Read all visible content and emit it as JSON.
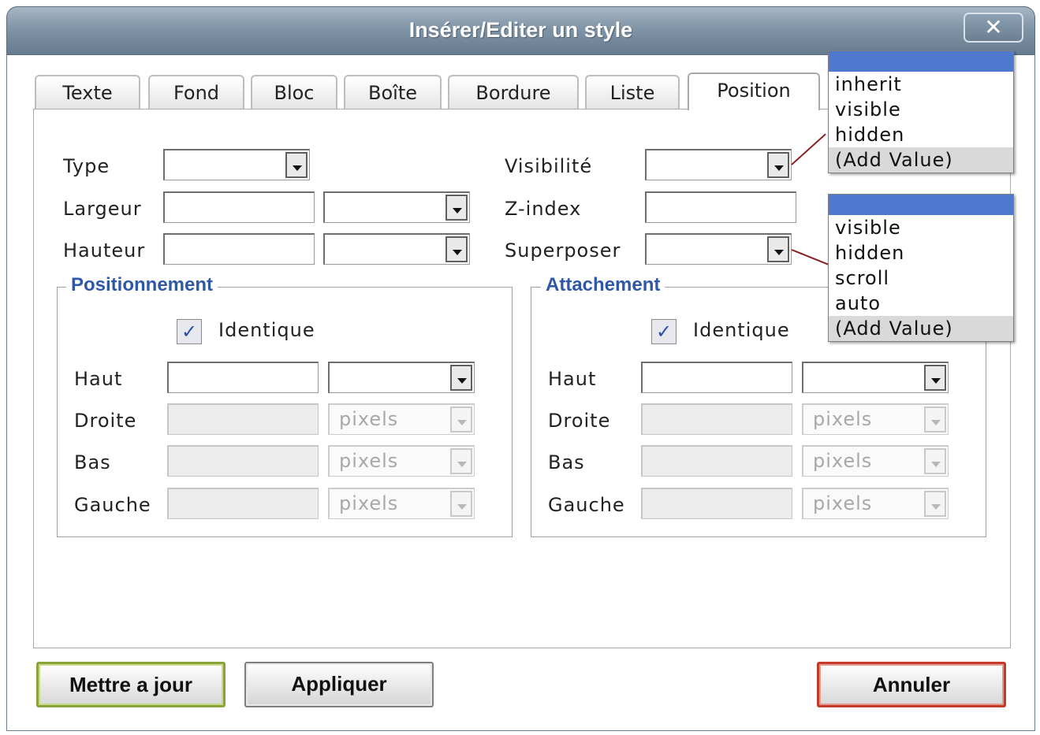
{
  "dialog": {
    "title": "Insérer/Editer un style",
    "close_label": "✕"
  },
  "tabs": [
    {
      "label": "Texte",
      "active": false
    },
    {
      "label": "Fond",
      "active": false
    },
    {
      "label": "Bloc",
      "active": false
    },
    {
      "label": "Boîte",
      "active": false
    },
    {
      "label": "Bordure",
      "active": false
    },
    {
      "label": "Liste",
      "active": false
    },
    {
      "label": "Position",
      "active": true
    }
  ],
  "fields": {
    "type_label": "Type",
    "largeur_label": "Largeur",
    "hauteur_label": "Hauteur",
    "visibilite_label": "Visibilité",
    "zindex_label": "Z-index",
    "superposer_label": "Superposer"
  },
  "positionnement": {
    "legend": "Positionnement",
    "identique_label": "Identique",
    "identique_checked": true,
    "haut_label": "Haut",
    "droite_label": "Droite",
    "bas_label": "Bas",
    "gauche_label": "Gauche",
    "unit_value": "pixels"
  },
  "attachement": {
    "legend": "Attachement",
    "identique_label": "Identique",
    "identique_checked": true,
    "haut_label": "Haut",
    "droite_label": "Droite",
    "bas_label": "Bas",
    "gauche_label": "Gauche",
    "unit_value": "pixels"
  },
  "visibility_dropdown": {
    "options": [
      "inherit",
      "visible",
      "hidden",
      "(Add Value)"
    ]
  },
  "overflow_dropdown": {
    "options": [
      "visible",
      "hidden",
      "scroll",
      "auto",
      "(Add Value)"
    ]
  },
  "buttons": {
    "update": "Mettre a jour",
    "apply": "Appliquer",
    "cancel": "Annuler"
  },
  "colors": {
    "titlebar": "#8195a8",
    "legend_text": "#2f58a8",
    "dropdown_highlight": "#4f79cf",
    "update_border": "#8aa23a",
    "cancel_border": "#c43a2a"
  }
}
